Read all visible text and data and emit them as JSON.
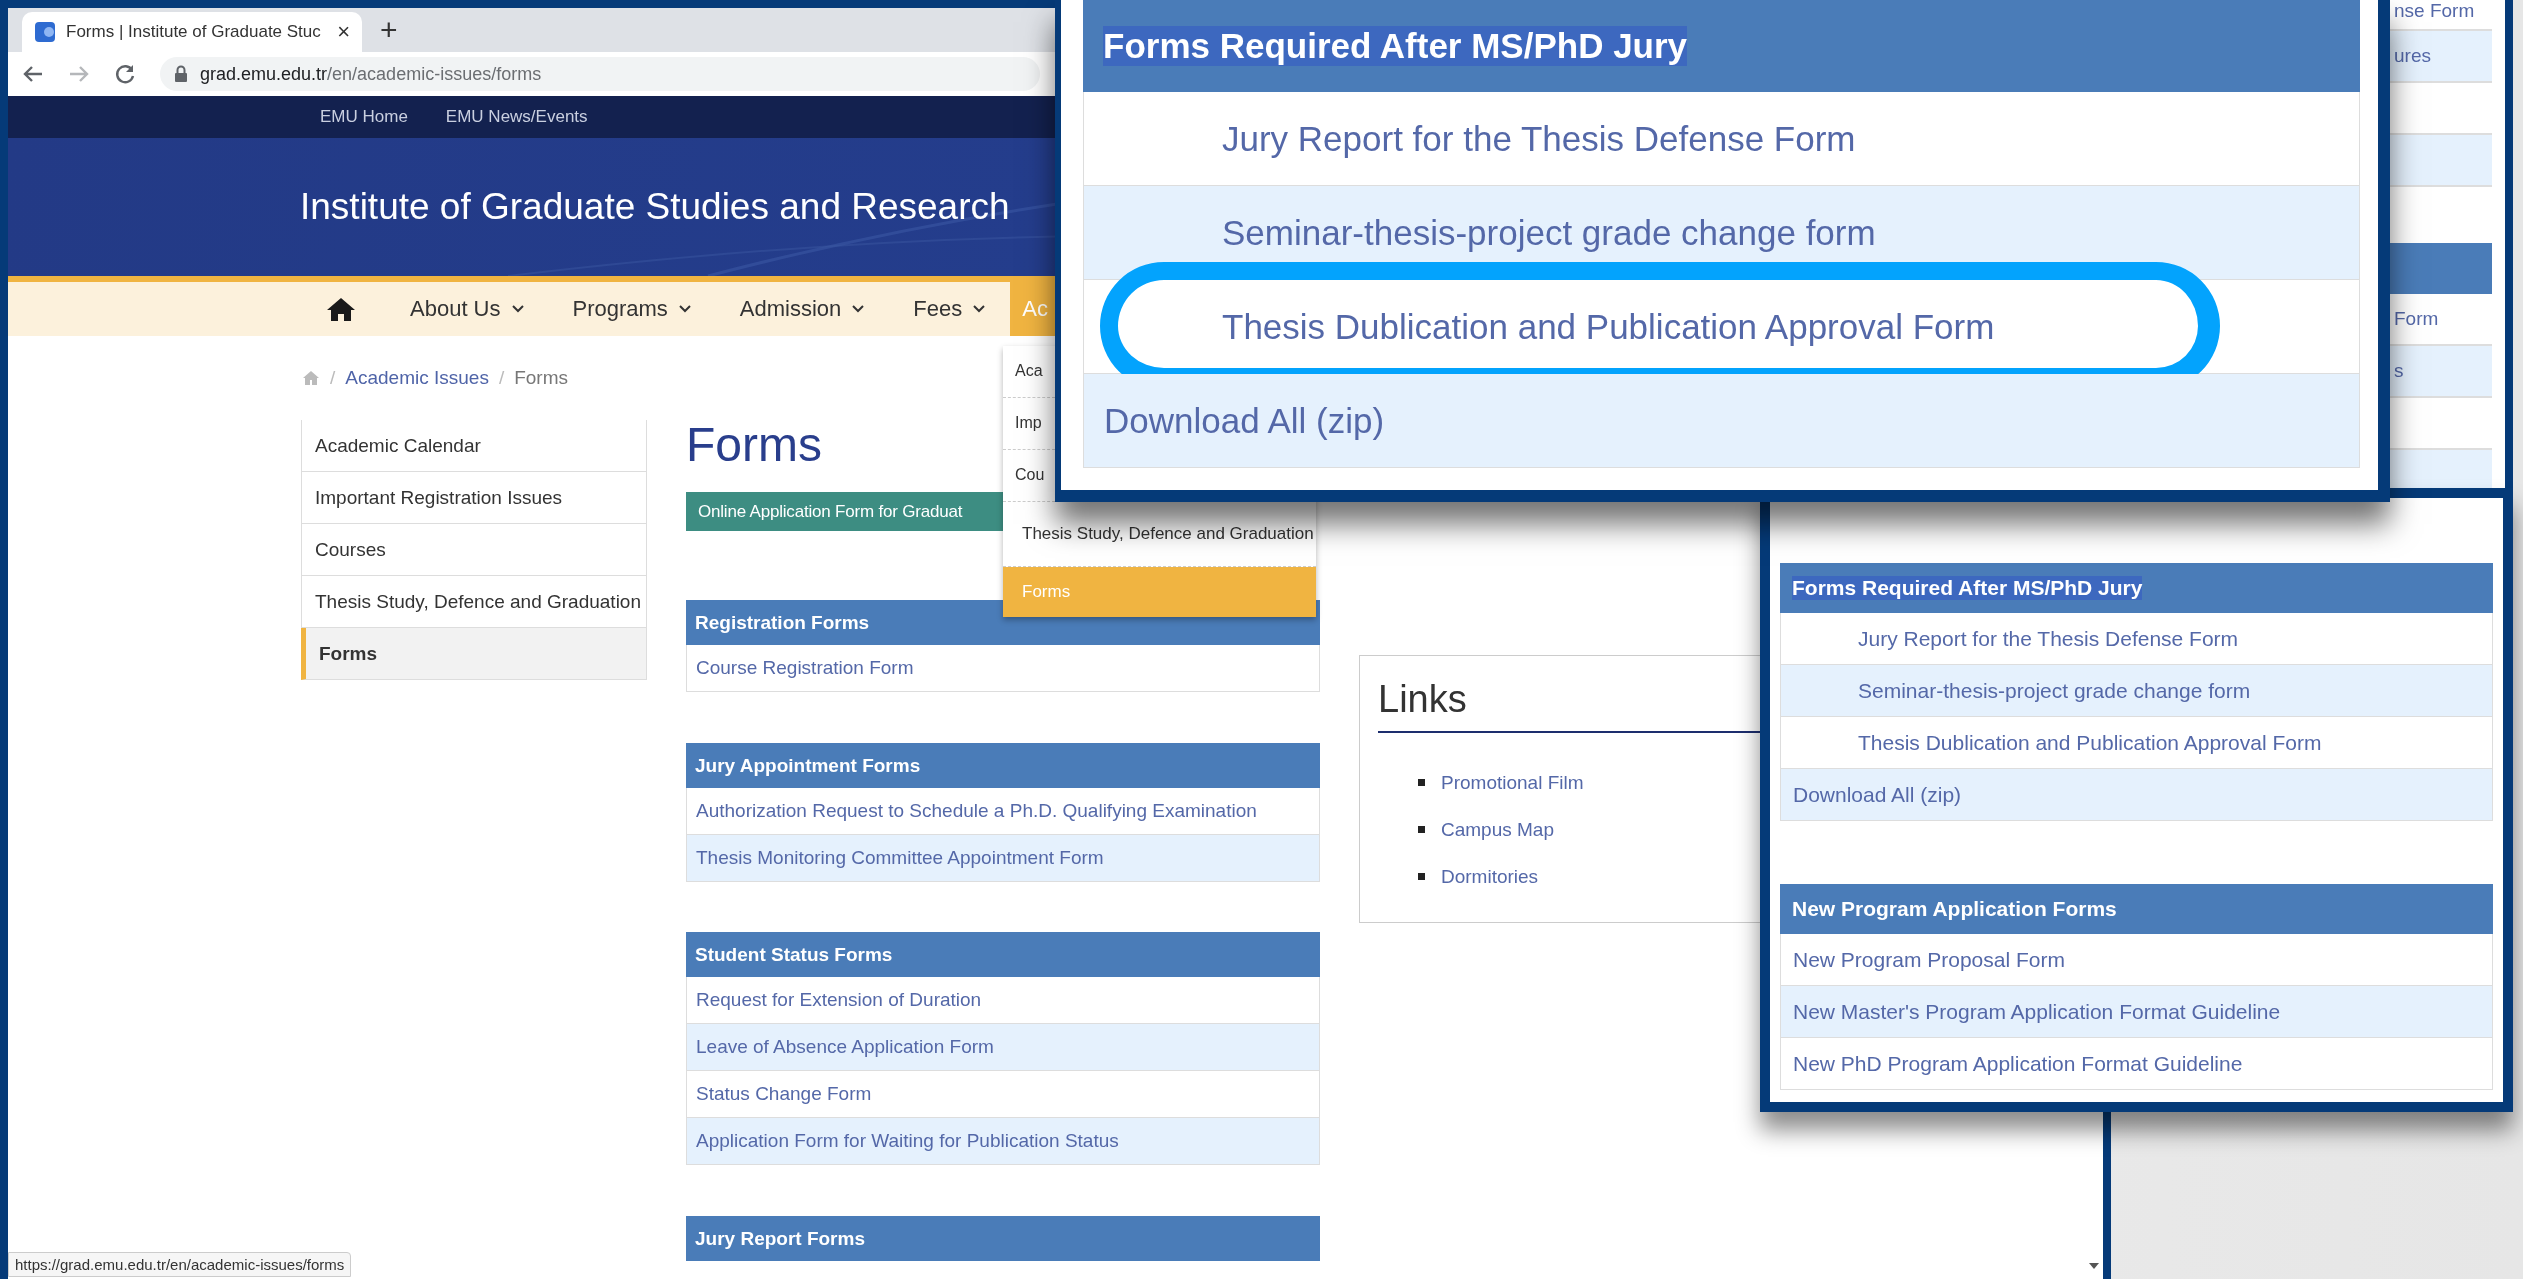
{
  "browser": {
    "tab_title": "Forms | Institute of Graduate Stuc",
    "close_tab": "×",
    "new_tab": "+",
    "url_host": "grad.emu.edu.tr",
    "url_path": "/en/academic-issues/forms",
    "status_url": "https://grad.emu.edu.tr/en/academic-issues/forms"
  },
  "top_links": [
    "EMU Home",
    "EMU News/Events"
  ],
  "site_title": "Institute of Graduate Studies and Research",
  "nav": [
    {
      "label": "About Us",
      "selected": false
    },
    {
      "label": "Programs",
      "selected": false
    },
    {
      "label": "Admission",
      "selected": false
    },
    {
      "label": "Fees",
      "selected": false
    },
    {
      "label": "Ac",
      "selected": true
    }
  ],
  "dropdown": [
    {
      "label": "Aca",
      "selected": false
    },
    {
      "label": "Imp",
      "selected": false
    },
    {
      "label": "Cou",
      "selected": false
    },
    {
      "label": "Thesis Study, Defence and Graduation",
      "selected": false
    },
    {
      "label": "Forms",
      "selected": true
    }
  ],
  "breadcrumb": [
    {
      "kind": "separator",
      "text": "/"
    },
    {
      "kind": "link",
      "text": "Academic Issues"
    },
    {
      "kind": "separator",
      "text": "/"
    },
    {
      "kind": "current",
      "text": "Forms"
    }
  ],
  "sidebar": [
    {
      "label": "Academic Calendar",
      "selected": false
    },
    {
      "label": "Important Registration Issues",
      "selected": false
    },
    {
      "label": "Courses",
      "selected": false
    },
    {
      "label": "Thesis Study, Defence and Graduation",
      "selected": false
    },
    {
      "label": "Forms",
      "selected": true
    }
  ],
  "page_title": "Forms",
  "online_button": "Online Application Form for Graduat",
  "form_groups": [
    {
      "title": "Registration Forms",
      "items": [
        {
          "text": "Course Registration Form"
        }
      ]
    },
    {
      "title": "Jury Appointment Forms",
      "items": [
        {
          "text": "Authorization Request to Schedule a Ph.D. Qualifying Examination"
        },
        {
          "text": "Thesis Monitoring Committee Appointment Form"
        }
      ]
    },
    {
      "title": "Student Status Forms",
      "items": [
        {
          "text": "Request for Extension of Duration"
        },
        {
          "text": "Leave of Absence Application Form"
        },
        {
          "text": "Status Change Form"
        },
        {
          "text": "Application Form for Waiting for Publication Status"
        }
      ]
    },
    {
      "title": "Jury Report Forms"
    }
  ],
  "links": {
    "title": "Links",
    "items": [
      "Promotional Film",
      "Campus Map",
      "Dormitories"
    ]
  },
  "back_panel": {
    "first_rows": [
      "nse Form",
      "ures"
    ],
    "second_rows": [
      "Form",
      "s"
    ]
  },
  "callouts": [
    {
      "groups": [
        {
          "title": "Forms Required After MS/PhD Jury",
          "title_selected": true,
          "items": [
            {
              "text": "Jury Report for the Thesis Defense Form",
              "indented": true,
              "circled": false
            },
            {
              "text": "Seminar-thesis-project grade change form",
              "indented": true,
              "circled": false
            },
            {
              "text": "Thesis Dublication and Publication Approval Form",
              "indented": true,
              "circled": true
            },
            {
              "text": "Download All (zip)",
              "indented": false,
              "circled": false
            }
          ]
        }
      ]
    },
    {
      "groups": [
        {
          "title": "Forms Required After MS/PhD Jury",
          "title_selected": true,
          "items": [
            {
              "text": "Jury Report for the Thesis Defense Form",
              "indented": true,
              "circled": false
            },
            {
              "text": "Seminar-thesis-project grade change form",
              "indented": true,
              "circled": false
            },
            {
              "text": "Thesis Dublication and Publication Approval Form",
              "indented": true,
              "circled": false
            },
            {
              "text": "Download All (zip)",
              "indented": false,
              "circled": false
            }
          ]
        },
        {
          "title": "New Program Application Forms",
          "title_selected": false,
          "items": [
            {
              "text": "New Program Proposal Form",
              "indented": false,
              "circled": false
            },
            {
              "text": "New Master's Program Application Format Guideline",
              "indented": false,
              "circled": false
            },
            {
              "text": "New PhD Program Application Format Guideline",
              "indented": false,
              "circled": false
            }
          ]
        }
      ]
    }
  ]
}
